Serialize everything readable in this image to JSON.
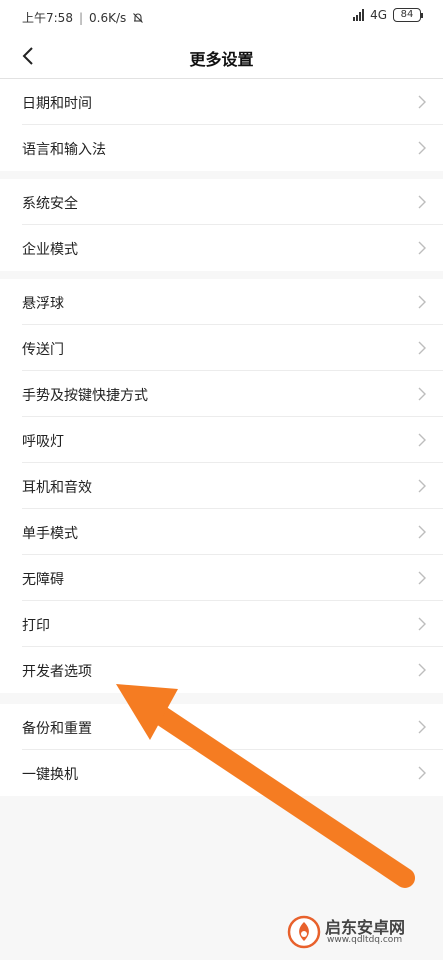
{
  "status_bar": {
    "time": "上午7:58",
    "separator": "|",
    "speed": "0.6K/s",
    "network": "4G",
    "battery": "84"
  },
  "header": {
    "title": "更多设置",
    "back_icon": "chevron-left-icon"
  },
  "groups": [
    {
      "items": [
        {
          "label": "日期和时间"
        },
        {
          "label": "语言和输入法"
        }
      ]
    },
    {
      "items": [
        {
          "label": "系统安全"
        },
        {
          "label": "企业模式"
        }
      ]
    },
    {
      "items": [
        {
          "label": "悬浮球"
        },
        {
          "label": "传送门"
        },
        {
          "label": "手势及按键快捷方式"
        },
        {
          "label": "呼吸灯"
        },
        {
          "label": "耳机和音效"
        },
        {
          "label": "单手模式"
        },
        {
          "label": "无障碍"
        },
        {
          "label": "打印"
        },
        {
          "label": "开发者选项"
        }
      ]
    },
    {
      "items": [
        {
          "label": "备份和重置"
        },
        {
          "label": "一键换机"
        }
      ]
    }
  ],
  "annotation": {
    "arrow_color": "#f57c22",
    "target": "开发者选项"
  },
  "watermark": {
    "name": "启东安卓网",
    "url": "www.qdltdq.com",
    "icon": "flame-logo-icon",
    "color": "#e8612c"
  }
}
